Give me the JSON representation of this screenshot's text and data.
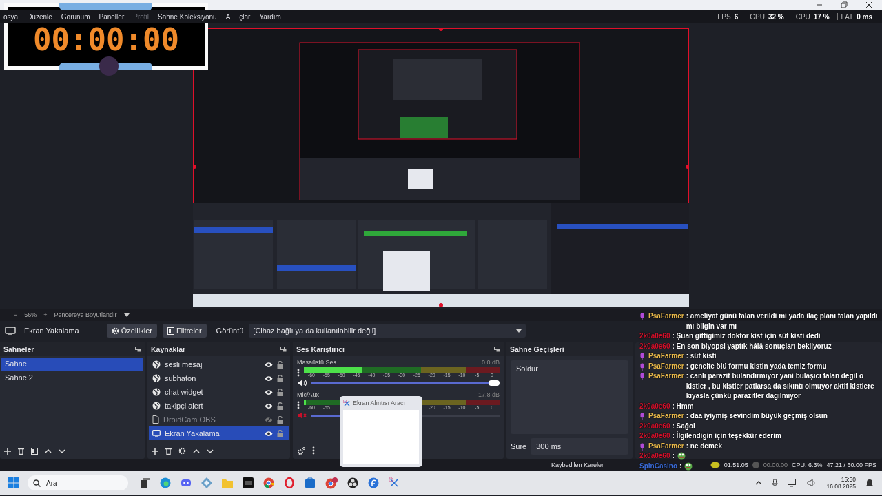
{
  "timer_overlay": {
    "time": "00:00:00"
  },
  "menu": [
    {
      "label": "osya",
      "disabled": false
    },
    {
      "label": "Düzenle",
      "disabled": false
    },
    {
      "label": "Görünüm",
      "disabled": false
    },
    {
      "label": "Paneller",
      "disabled": false
    },
    {
      "label": "Profil",
      "disabled": true
    },
    {
      "label": "Sahne Koleksiyonu",
      "disabled": false
    },
    {
      "label": "A",
      "disabled": false
    },
    {
      "label": "çlar",
      "disabled": false
    },
    {
      "label": "Yardım",
      "disabled": false
    }
  ],
  "stats": [
    {
      "label": "FPS",
      "value": "6"
    },
    {
      "label": "GPU",
      "value": "32 %"
    },
    {
      "label": "CPU",
      "value": "17 %"
    },
    {
      "label": "LAT",
      "value": "0 ms"
    }
  ],
  "zoom_bar": {
    "minus": "−",
    "zoom": "56%",
    "plus": "+",
    "fit": "Pencereye Boyutlandır"
  },
  "source_toolbar": {
    "source": "Ekran Yakalama",
    "properties": "Özellikler",
    "filters": "Filtreler",
    "display_label": "Görüntü",
    "display_value": "[Cihaz bağlı ya da kullanılabilir değil]"
  },
  "scenes": {
    "title": "Sahneler",
    "items": [
      {
        "label": "Sahne",
        "selected": true
      },
      {
        "label": "Sahne 2",
        "selected": false
      }
    ]
  },
  "sources": {
    "title": "Kaynaklar",
    "items": [
      {
        "label": "sesli mesaj",
        "kind": "browser",
        "visible": true,
        "selected": false
      },
      {
        "label": "subhaton",
        "kind": "browser",
        "visible": true,
        "selected": false
      },
      {
        "label": "chat widget",
        "kind": "browser",
        "visible": true,
        "selected": false
      },
      {
        "label": "takipçi alert",
        "kind": "browser",
        "visible": true,
        "selected": false
      },
      {
        "label": "DroidCam OBS",
        "kind": "media",
        "visible": false,
        "selected": false
      },
      {
        "label": "Ekran Yakalama",
        "kind": "display",
        "visible": true,
        "selected": true
      }
    ]
  },
  "mixer": {
    "title": "Ses Karıştırıcı",
    "channels": [
      {
        "name": "Masaüstü Ses",
        "reading": "0.0 dB",
        "muted": false,
        "meter": {
          "level": 0.3
        },
        "volume": {
          "level": 1.0
        },
        "scale": [
          "-60",
          "-55",
          "-50",
          "-45",
          "-40",
          "-35",
          "-30",
          "-25",
          "-20",
          "-15",
          "-10",
          "-5",
          "0"
        ]
      },
      {
        "name": "Mic/Aux",
        "reading": "-17.8 dB",
        "muted": true,
        "meter": {
          "level": 0.01
        },
        "volume": {
          "level": 0.35
        },
        "scale": [
          "-60",
          "-55",
          "-20",
          "-15",
          "-10",
          "-5",
          "0"
        ]
      }
    ]
  },
  "transitions": {
    "title": "Sahne Geçişleri",
    "transition": "Soldur",
    "duration_label": "Süre",
    "duration": "300 ms"
  },
  "chat": {
    "messages": [
      {
        "user": "PsaFarmer",
        "color": "#e8b84a",
        "badge": true,
        "kind": "text",
        "text": ": ameliyat günü falan verildi mi yada ilaç planı falan yapıldı mı bilgin var mı"
      },
      {
        "user": "2k0a0e60",
        "color": "#d0102a",
        "badge": false,
        "kind": "text",
        "text": ": Şuan gittiğimiz doktor kist için süt kisti dedi"
      },
      {
        "user": "2k0a0e60",
        "color": "#d0102a",
        "badge": false,
        "kind": "text",
        "text": ": En son biyopsi yaptık hâlâ sonuçları bekliyoruz"
      },
      {
        "user": "PsaFarmer",
        "color": "#e8b84a",
        "badge": true,
        "kind": "text",
        "text": ": süt kisti"
      },
      {
        "user": "PsaFarmer",
        "color": "#e8b84a",
        "badge": true,
        "kind": "text",
        "text": ": genelte ölü formu kistin yada temiz formu"
      },
      {
        "user": "PsaFarmer",
        "color": "#e8b84a",
        "badge": true,
        "kind": "text",
        "text": ": canlı parazit bulandırmıyor yani bulaşıcı falan değil o kistler , bu kistler patlarsa da sıkıntı olmuyor aktif kistlere kıyasla çünkü parazitler dağılmıyor"
      },
      {
        "user": "2k0a0e60",
        "color": "#d0102a",
        "badge": false,
        "kind": "text",
        "text": ": Hmm"
      },
      {
        "user": "PsaFarmer",
        "color": "#e8b84a",
        "badge": true,
        "kind": "text",
        "text": ": daa iyiymiş sevindim büyük geçmiş olsun"
      },
      {
        "user": "2k0a0e60",
        "color": "#d0102a",
        "badge": false,
        "kind": "text",
        "text": ": Sağol"
      },
      {
        "user": "2k0a0e60",
        "color": "#d0102a",
        "badge": false,
        "kind": "text",
        "text": ": İlgilendiğin için teşekkür ederim"
      },
      {
        "user": "PsaFarmer",
        "color": "#e8b84a",
        "badge": true,
        "kind": "text",
        "text": ": ne demek"
      },
      {
        "user": "2k0a0e60",
        "color": "#d0102a",
        "badge": false,
        "kind": "emote",
        "text": ":"
      },
      {
        "user": "SpinCasino",
        "color": "#3a6bd8",
        "badge": false,
        "kind": "emote",
        "text": ":"
      }
    ]
  },
  "status_bar": {
    "dropped": "Kaybedilen Kareler",
    "stream_time": "01:51:05",
    "rec_time": "00:00:00",
    "cpu": "CPU: 6.3%",
    "fps": "47.21 / 60.00 FPS"
  },
  "snip_preview": {
    "title": "Ekran Alıntısı Aracı"
  },
  "taskbar": {
    "search": "Ara",
    "time": "15:50",
    "date": "16.08.2025"
  }
}
